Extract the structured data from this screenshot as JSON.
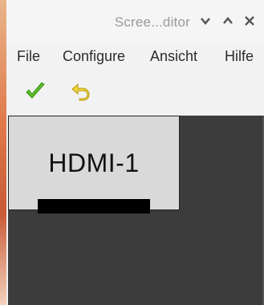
{
  "window": {
    "title": "Scree...ditor",
    "controls": {
      "minimize": "⌄",
      "maximize": "^",
      "close": "✕"
    }
  },
  "menu": {
    "items": [
      "File",
      "Configure",
      "Ansicht",
      "Hilfe"
    ]
  },
  "toolbar": {
    "apply_icon": "checkmark-icon",
    "undo_icon": "undo-arrow-icon",
    "colors": {
      "apply": "#4caf2a",
      "undo": "#e6c619"
    }
  },
  "layout": {
    "monitors": [
      {
        "label": "HDMI-1"
      }
    ],
    "canvas_color": "#3c3c3c"
  }
}
